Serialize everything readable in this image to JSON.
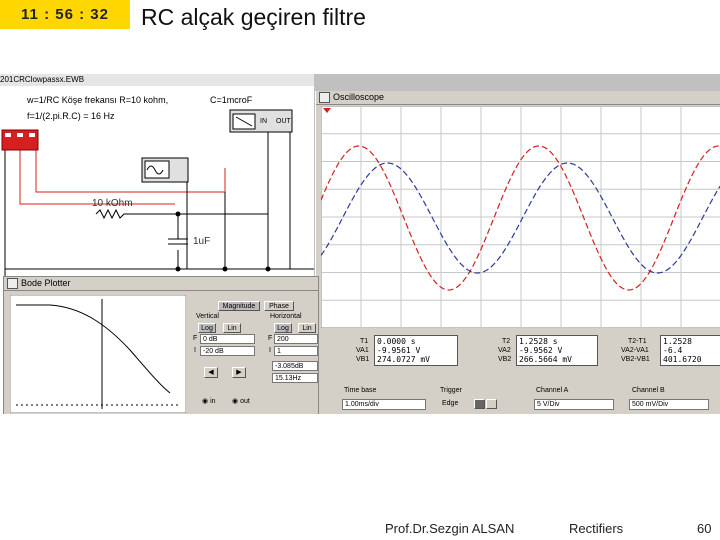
{
  "slide": {
    "clock": "11 : 56 : 32",
    "title": "RC alçak geçiren filtre",
    "footer_author": "Prof.Dr.Sezgin ALSAN",
    "footer_topic": "Rectifiers",
    "page_number": "60"
  },
  "circuit": {
    "file_title": "201CRClowpassx.EWB",
    "note_line1": "w=1/RC Köşe frekansı R=10 kohm,",
    "note_line1b": "C=1mcroF",
    "note_line2": "f=1/(2.pi.R.C) = 16 Hz",
    "resistor_label": "10 kOhm",
    "capacitor_label": "1uF",
    "bode_in": "IN",
    "bode_out": "OUT"
  },
  "oscilloscope": {
    "title": "Oscilloscope",
    "t1": {
      "label": "T1",
      "time": "0.0000",
      "time_unit": "s",
      "va_label": "VA1",
      "va": "-9.9561",
      "va_unit": "V",
      "vb_label": "VB1",
      "vb": "274.0727",
      "vb_unit": "mV"
    },
    "t2": {
      "label": "T2",
      "time": "1.2528",
      "time_unit": "s",
      "va_label": "VA2",
      "va": "-9.9562",
      "va_unit": "V",
      "vb_label": "VB2",
      "vb": "266.5664",
      "vb_unit": "mV"
    },
    "dt": {
      "label": "T2-T1",
      "time": "1.2528",
      "va_label": "VA2-VA1",
      "va": "-6.4",
      "vb_label": "VB2-VB1",
      "vb": "401.6720"
    },
    "timebase": {
      "label": "Time base",
      "value": "1.00ms/div"
    },
    "trigger": {
      "label": "Trigger",
      "edge": "Edge"
    },
    "channel_a": {
      "label": "Channel A",
      "value": "5 V/Div"
    },
    "channel_b": {
      "label": "Channel B",
      "value": "500 mV/Div"
    },
    "colors": {
      "red": "#d42020",
      "blue": "#2a3c9a"
    }
  },
  "bode": {
    "title": "Bode Plotter",
    "magnitude": "Magnitude",
    "phase": "Phase",
    "vertical": "Vertical",
    "horizontal": "Horizontal",
    "log": "Log",
    "lin": "Lin",
    "v_final": "0 dB",
    "v_initial": "-20 dB",
    "h_final": "200",
    "h_initial": "1",
    "f_label": "F",
    "i_label": "I",
    "readout_db": "-3.085dB",
    "readout_hz": "15.13Hz",
    "in_label": "in",
    "out_label": "out"
  }
}
